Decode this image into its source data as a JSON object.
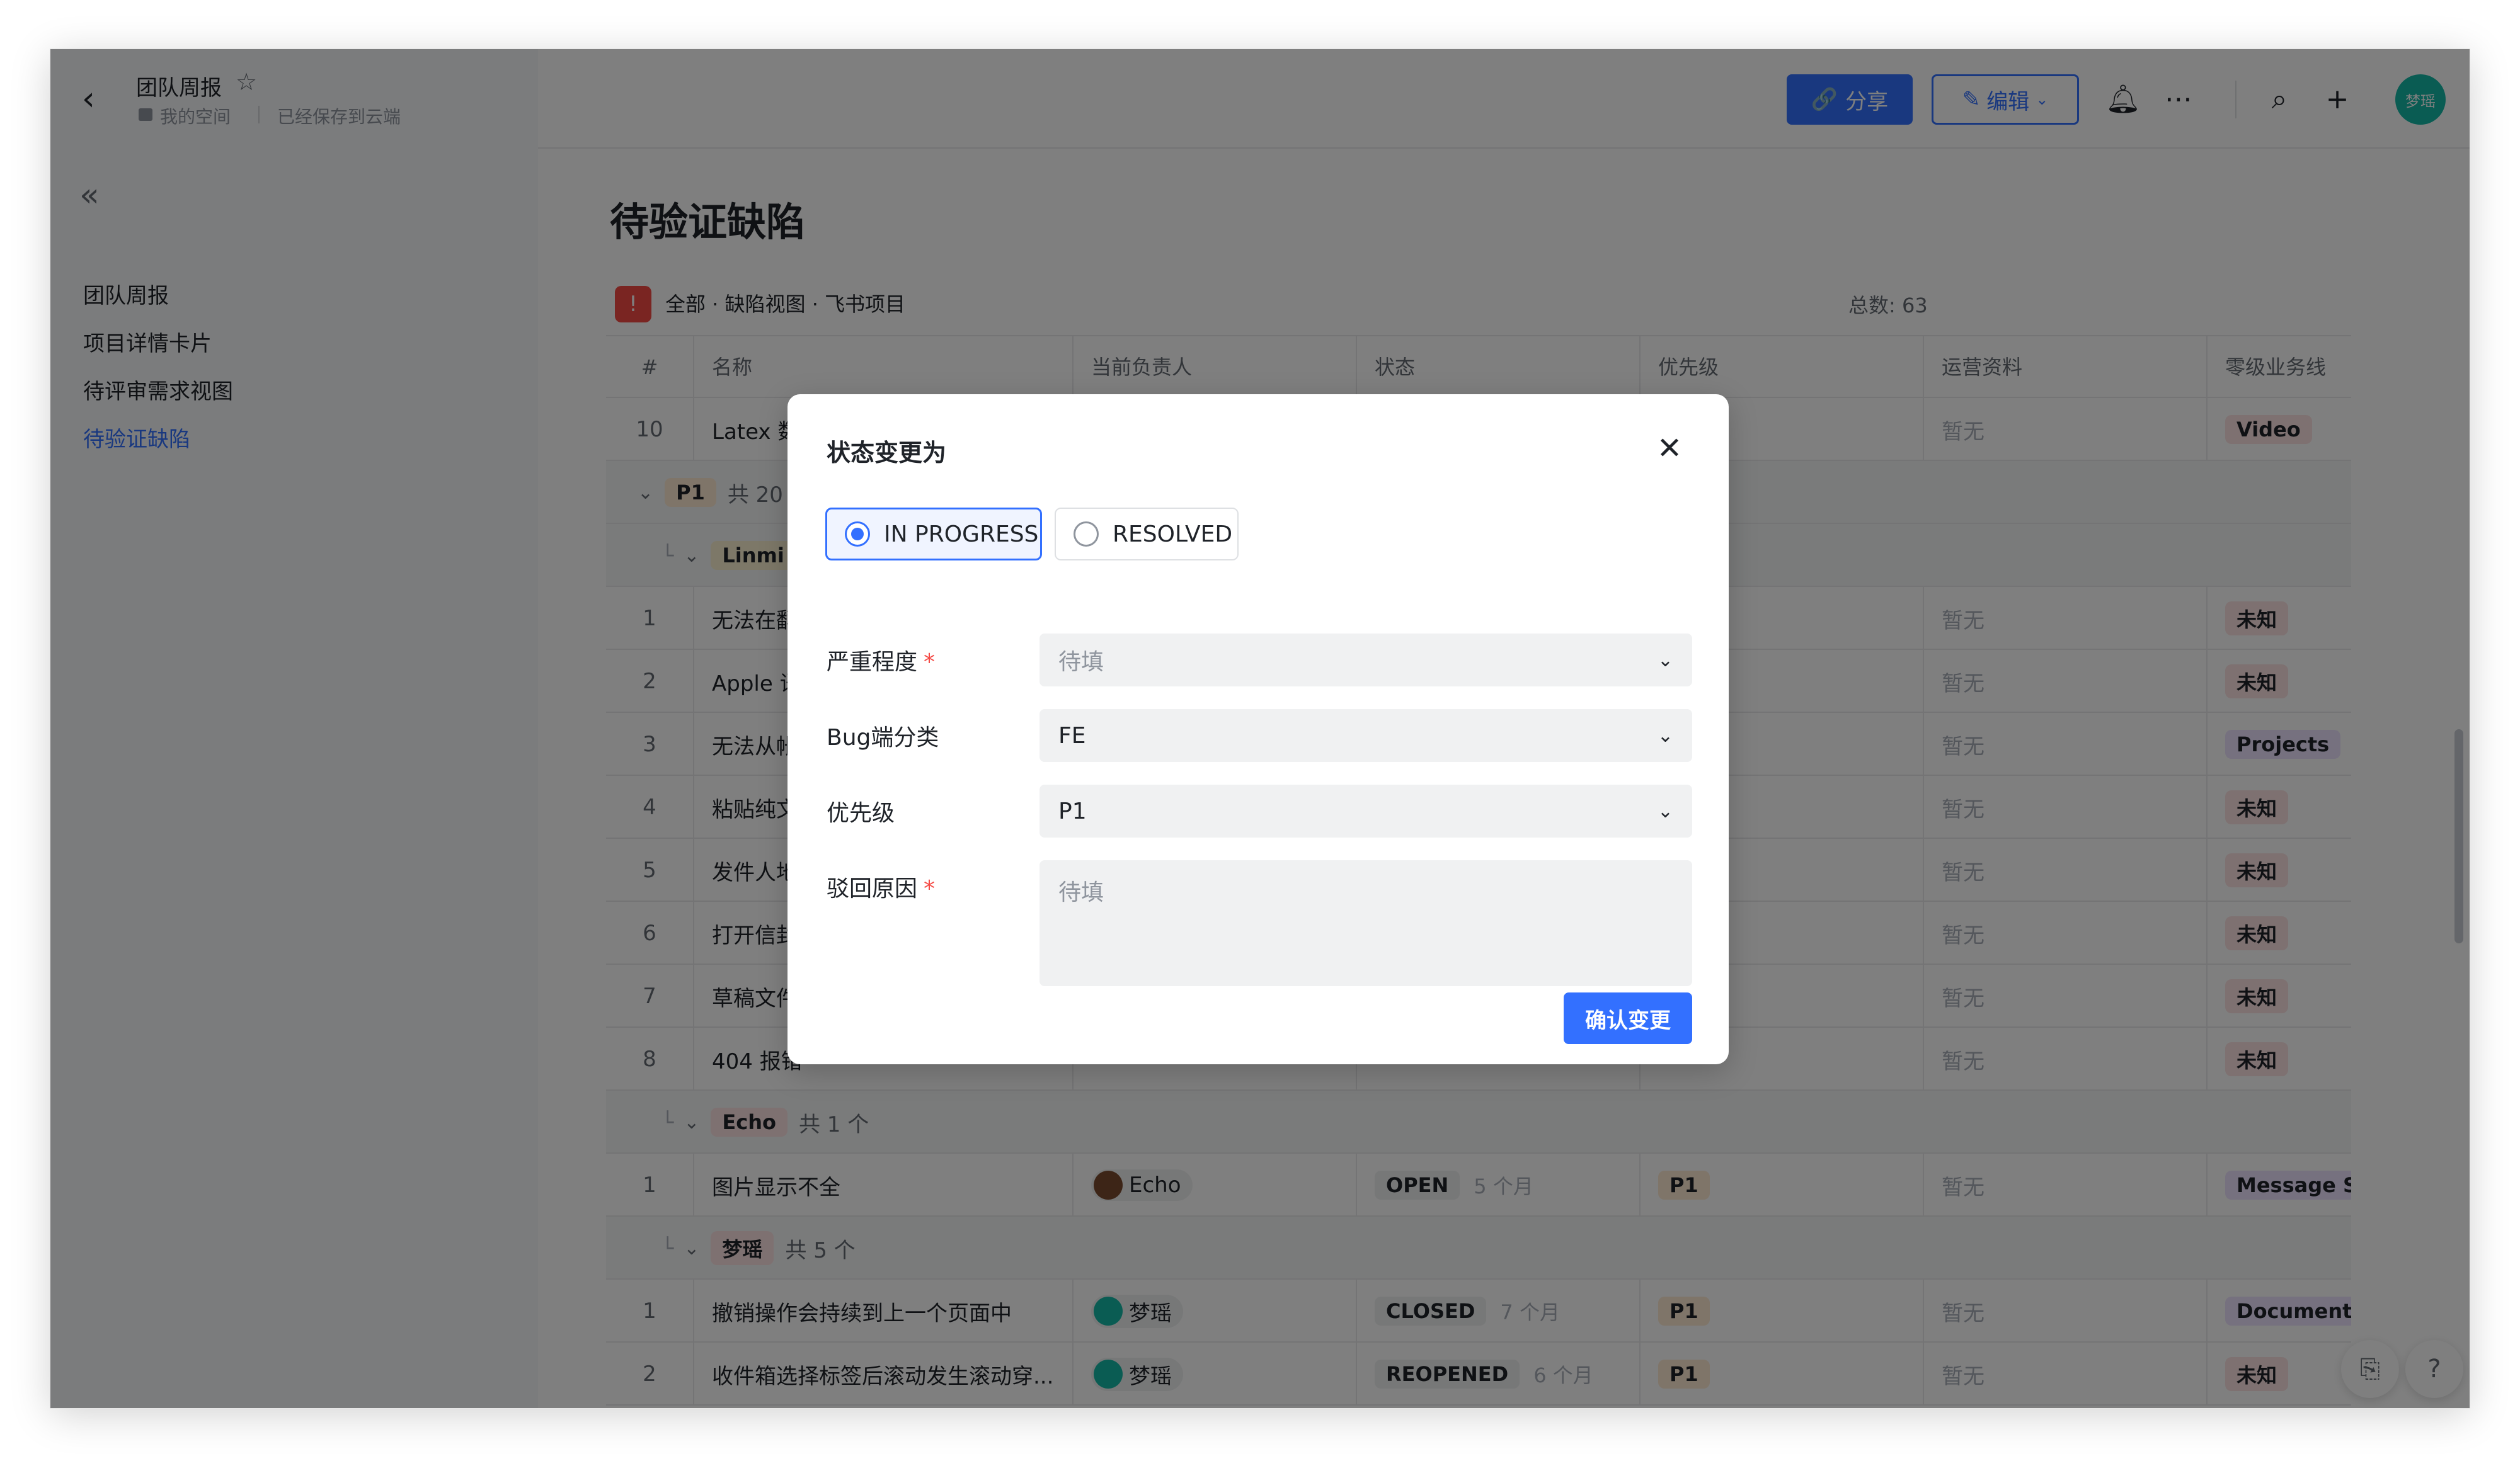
{
  "header": {
    "doc_title": "团队周报",
    "space_label": "我的空间",
    "saved_label": "已经保存到云端",
    "share_label": "分享",
    "edit_label": "编辑",
    "avatar_label": "梦瑶"
  },
  "sidebar": {
    "items": [
      {
        "label": "团队周报"
      },
      {
        "label": "项目详情卡片"
      },
      {
        "label": "待评审需求视图"
      },
      {
        "label": "待验证缺陷"
      }
    ]
  },
  "main": {
    "page_title": "待验证缺陷",
    "view_path": "全部 · 缺陷视图 · 飞书项目",
    "total_count": "总数: 63",
    "columns": [
      "#",
      "名称",
      "当前负责人",
      "状态",
      "优先级",
      "运营资料",
      "零级业务线"
    ],
    "rows": [
      {
        "kind": "item",
        "num": "10",
        "name": "Latex 数",
        "ops": "暂无",
        "biz": "Video",
        "biz_color": "pink"
      },
      {
        "kind": "group",
        "label": "P1",
        "count": "共 20",
        "level": 0
      },
      {
        "kind": "group",
        "label": "Linmi",
        "count": "",
        "level": 1
      },
      {
        "kind": "item",
        "num": "1",
        "name": "无法在翻",
        "ops": "暂无",
        "biz": "未知",
        "biz_color": "pink"
      },
      {
        "kind": "item",
        "num": "2",
        "name": "Apple 语",
        "ops": "暂无",
        "biz": "未知",
        "biz_color": "pink"
      },
      {
        "kind": "item",
        "num": "3",
        "name": "无法从帐",
        "ops": "暂无",
        "biz": "Projects",
        "biz_color": "purple"
      },
      {
        "kind": "item",
        "num": "4",
        "name": "粘贴纯文",
        "ops": "暂无",
        "biz": "未知",
        "biz_color": "pink"
      },
      {
        "kind": "item",
        "num": "5",
        "name": "发件人地",
        "ops": "暂无",
        "biz": "未知",
        "biz_color": "pink"
      },
      {
        "kind": "item",
        "num": "6",
        "name": "打开信封",
        "ops": "暂无",
        "biz": "未知",
        "biz_color": "pink"
      },
      {
        "kind": "item",
        "num": "7",
        "name": "草稿文件",
        "ops": "暂无",
        "biz": "未知",
        "biz_color": "pink"
      },
      {
        "kind": "item",
        "num": "8",
        "name": "404 报错",
        "ops": "暂无",
        "biz": "未知",
        "biz_color": "pink"
      },
      {
        "kind": "group",
        "label": "Echo",
        "count": "共 1 个",
        "level": 1
      },
      {
        "kind": "item",
        "num": "1",
        "name": "图片显示不全",
        "owner": "Echo",
        "owner_avatar": "echo",
        "status": "OPEN",
        "ago": "5 个月",
        "prio": "P1",
        "ops": "暂无",
        "biz": "Message S",
        "biz_color": "purple"
      },
      {
        "kind": "group",
        "label": "梦瑶",
        "count": "共 5 个",
        "level": 1
      },
      {
        "kind": "item",
        "num": "1",
        "name": "撤销操作会持续到上一个页面中",
        "owner": "梦瑶",
        "owner_avatar": "my",
        "status": "CLOSED",
        "ago": "7 个月",
        "prio": "P1",
        "ops": "暂无",
        "biz": "Documents",
        "biz_color": "purple"
      },
      {
        "kind": "item",
        "num": "2",
        "name": "收件箱选择标签后滚动发生滚动穿...",
        "owner": "梦瑶",
        "owner_avatar": "my",
        "status": "REOPENED",
        "ago": "6 个月",
        "prio": "P1",
        "ops": "暂无",
        "biz": "未知",
        "biz_color": "pink"
      }
    ]
  },
  "modal": {
    "title": "状态变更为",
    "options": [
      {
        "label": "IN PROGRESS",
        "selected": true
      },
      {
        "label": "RESOLVED",
        "selected": false
      }
    ],
    "fields": [
      {
        "label": "严重程度",
        "required": true,
        "value": "",
        "placeholder": "待填"
      },
      {
        "label": "Bug端分类",
        "required": false,
        "value": "FE",
        "placeholder": ""
      },
      {
        "label": "优先级",
        "required": false,
        "value": "P1",
        "placeholder": ""
      },
      {
        "label": "驳回原因",
        "required": true,
        "value": "",
        "placeholder": "待填"
      }
    ],
    "confirm_label": "确认变更"
  },
  "colors": {
    "accent": "#3370ff",
    "overlay": "rgba(0,0,0,0.5)",
    "required": "#f54a45",
    "avatar": "#14b8a6"
  }
}
